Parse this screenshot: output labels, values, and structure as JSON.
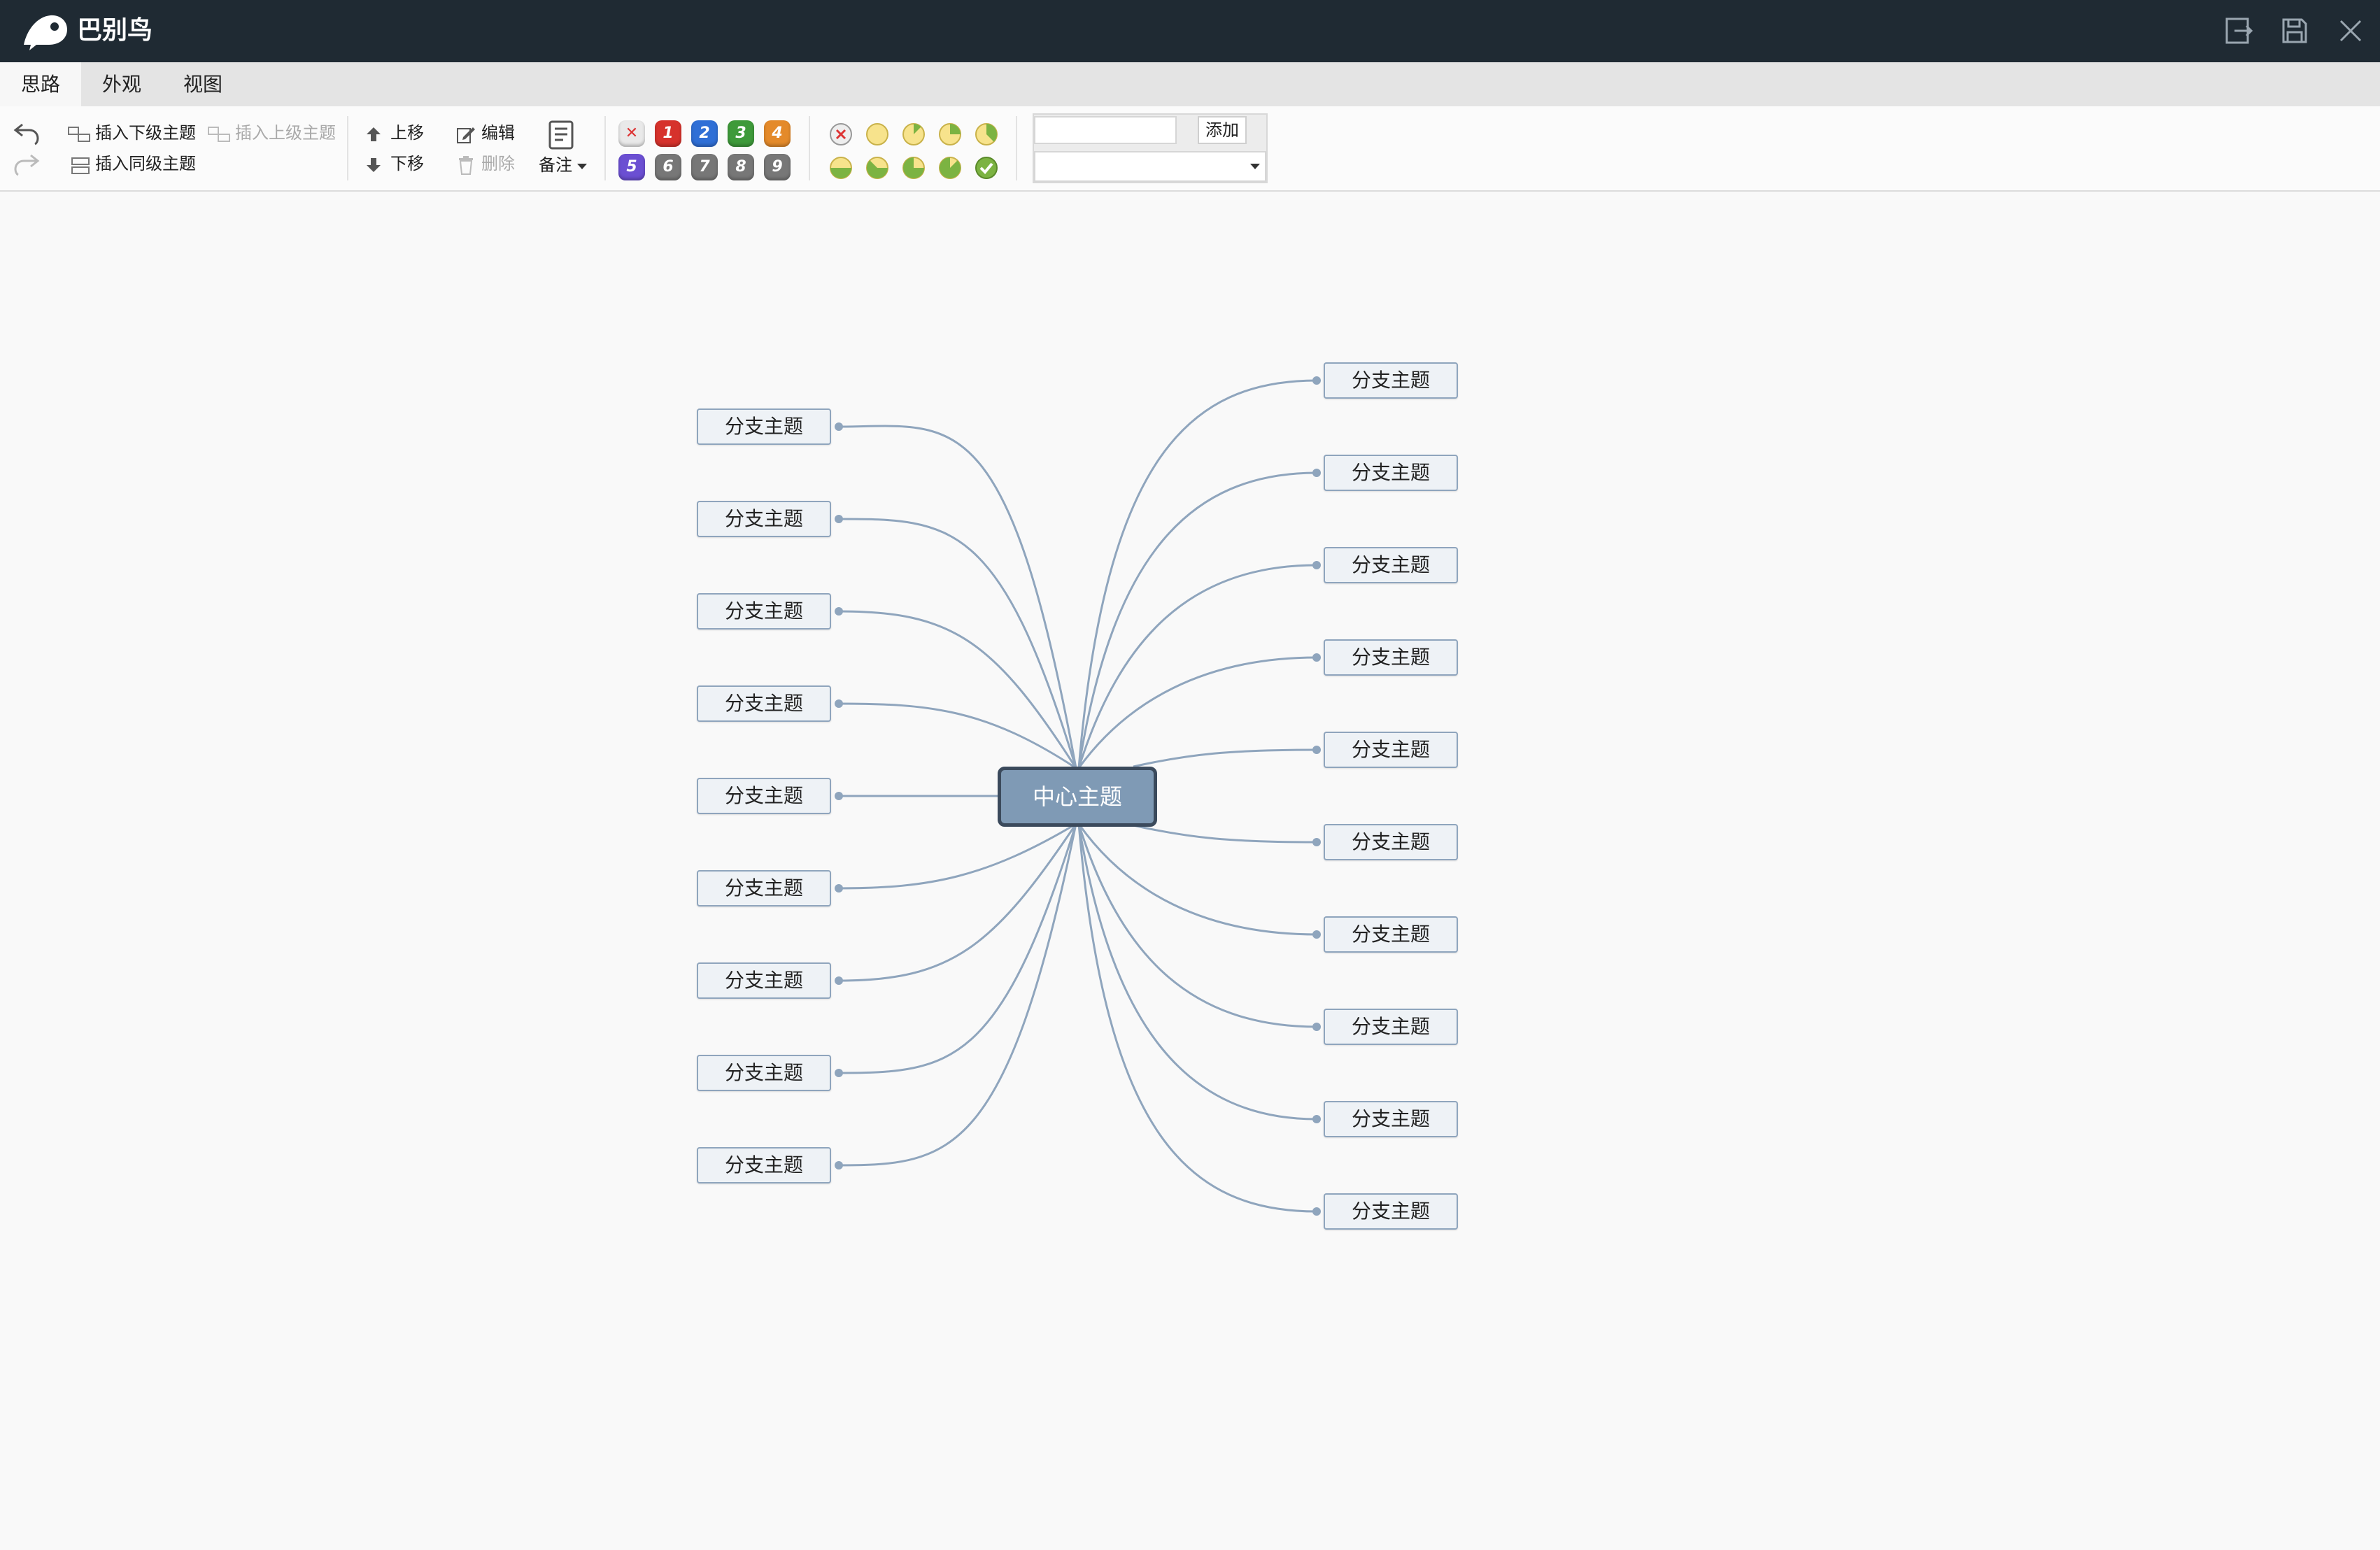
{
  "app": {
    "title": "巴别鸟"
  },
  "menu": {
    "tabs": [
      "思路",
      "外观",
      "视图"
    ],
    "active_index": 0
  },
  "toolbar": {
    "insert_child": "插入下级主题",
    "insert_parent": "插入上级主题",
    "insert_sibling": "插入同级主题",
    "move_up": "上移",
    "move_down": "下移",
    "edit": "编辑",
    "delete": "删除",
    "note": "备注",
    "priority_icons": [
      "1",
      "2",
      "3",
      "4",
      "5",
      "6",
      "7",
      "8",
      "9"
    ],
    "add_label": "添加",
    "tag_input_value": "",
    "tag_select_value": ""
  },
  "colors": {
    "titlebar": "#1f2a33",
    "accent_center": "#7f9ab5",
    "branch_border": "#8fa5bd",
    "line": "#8fa5bd"
  },
  "mindmap": {
    "center": "中心主题",
    "left_branches": [
      "分支主题",
      "分支主题",
      "分支主题",
      "分支主题",
      "分支主题",
      "分支主题",
      "分支主题",
      "分支主题",
      "分支主题"
    ],
    "right_branches": [
      "分支主题",
      "分支主题",
      "分支主题",
      "分支主题",
      "分支主题",
      "分支主题",
      "分支主题",
      "分支主题",
      "分支主题",
      "分支主题"
    ]
  }
}
